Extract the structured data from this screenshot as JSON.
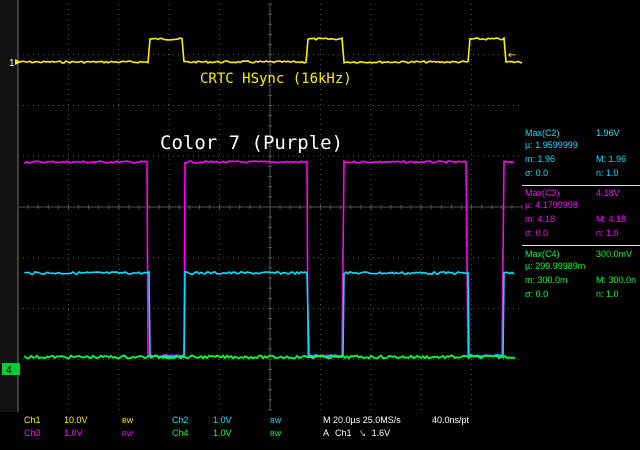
{
  "screen": {
    "background": "#000000",
    "grid_color": "#555555",
    "colors": {
      "ch1": "#ffee00",
      "ch2": "#00e0ff",
      "ch3": "#ff00ff",
      "ch4": "#00ff33",
      "text": "#ffffff"
    }
  },
  "markers": {
    "ch1_label": "1",
    "ch4_label": "4",
    "trigger_arrow": "←"
  },
  "annotations": {
    "hsync": "CRTC HSync (16kHz)",
    "color_title": "Color 7 (Purple)"
  },
  "measurements": [
    {
      "title": "Max(C2)",
      "value": "1.96V",
      "mu_label": "µ:",
      "mu": "1.9599999",
      "m_label": "m:",
      "m": "1.96",
      "M_label": "M:",
      "M": "1.96",
      "sigma_label": "σ:",
      "sigma": "0.0",
      "n_label": "n:",
      "n": "1.0",
      "color": "#00e0ff"
    },
    {
      "title": "Max(C3)",
      "value": "4.18V",
      "mu_label": "µ:",
      "mu": "4.1799998",
      "m_label": "m:",
      "m": "4.18",
      "M_label": "M:",
      "M": "4.18",
      "sigma_label": "σ:",
      "sigma": "0.0",
      "n_label": "n:",
      "n": "1.0",
      "color": "#ff00ff"
    },
    {
      "title": "Max(C4)",
      "value": "300.0mV",
      "mu_label": "µ:",
      "mu": "299.99989m",
      "m_label": "m:",
      "m": "300.0m",
      "M_label": "M:",
      "M": "300.0n",
      "sigma_label": "σ:",
      "sigma": "0.0",
      "n_label": "n:",
      "n": "1.0",
      "color": "#00ff33"
    }
  ],
  "channels": {
    "ch1": {
      "label": "Ch1",
      "scale": "10.0V",
      "bw": "BW"
    },
    "ch2": {
      "label": "Ch2",
      "scale": "1.0V",
      "bw": "BW"
    },
    "ch3": {
      "label": "Ch3",
      "scale": "1.0V",
      "bw": "BW"
    },
    "ch4": {
      "label": "Ch4",
      "scale": "1.0V",
      "bw": "BW"
    }
  },
  "timebase": {
    "main": "M 20.0µs 25.0MS/s",
    "resolution": "40.0ns/pt",
    "trigger_prefix": "A",
    "trigger_channel": "Ch1",
    "trigger_slope": "⤥",
    "trigger_level": "1.6V"
  }
}
